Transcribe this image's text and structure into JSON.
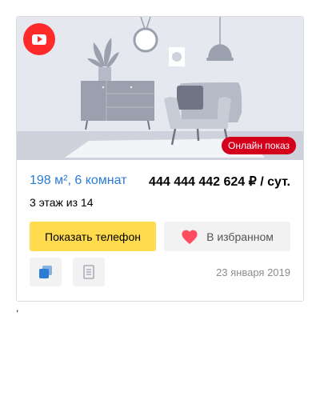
{
  "listing": {
    "area_rooms": "198 м², 6 комнат",
    "price": "444 444 442 624 ₽ / сут.",
    "floor": "3 этаж из 14",
    "online_badge": "Онлайн показ",
    "date": "23 января 2019",
    "video_icon": "youtube-play-icon"
  },
  "actions": {
    "show_phone": "Показать телефон",
    "favorite": "В избранном",
    "copy_icon": "copy-icon",
    "document_icon": "document-icon"
  },
  "stray_text": ",",
  "colors": {
    "accent_blue": "#2a7cd4",
    "phone_button": "#ffdb4d",
    "badge_red": "#d4001b",
    "heart": "#ff4d5f"
  }
}
